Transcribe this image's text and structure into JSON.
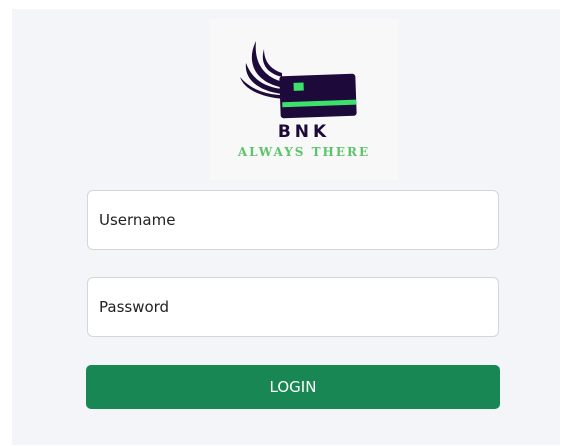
{
  "logo": {
    "brand": "BNK",
    "tagline": "ALWAYS THERE"
  },
  "form": {
    "username_placeholder": "Username",
    "password_placeholder": "Password",
    "login_label": "LOGIN"
  },
  "colors": {
    "panel_bg": "#f4f5f9",
    "card_dark": "#1d0a3a",
    "card_stripe": "#3de06a",
    "button": "#198754",
    "tagline": "#5cc46a"
  }
}
